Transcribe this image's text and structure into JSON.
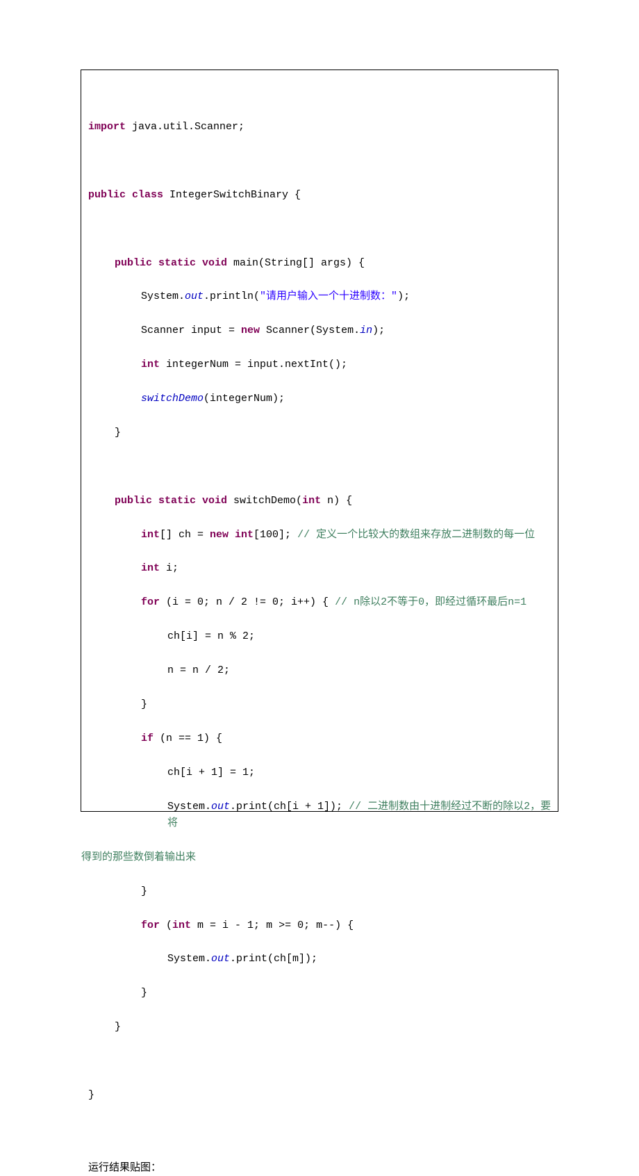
{
  "code": {
    "l1": [
      {
        "t": "import",
        "c": "kw"
      },
      {
        "t": " java.util.Scanner;",
        "c": "txt"
      }
    ],
    "l2": [
      {
        "t": "public class",
        "c": "kw"
      },
      {
        "t": " IntegerSwitchBinary {",
        "c": "txt"
      }
    ],
    "l3": [
      {
        "t": "public static void",
        "c": "kw"
      },
      {
        "t": " main(String[] args) {",
        "c": "txt"
      }
    ],
    "l4": [
      {
        "t": "System.",
        "c": "txt"
      },
      {
        "t": "out",
        "c": "fld"
      },
      {
        "t": ".println(",
        "c": "txt"
      },
      {
        "t": "\"请用户输入一个十进制数：\"",
        "c": "str"
      },
      {
        "t": ");",
        "c": "txt"
      }
    ],
    "l5": [
      {
        "t": "Scanner input = ",
        "c": "txt"
      },
      {
        "t": "new",
        "c": "kw"
      },
      {
        "t": " Scanner(System.",
        "c": "txt"
      },
      {
        "t": "in",
        "c": "fld"
      },
      {
        "t": ");",
        "c": "txt"
      }
    ],
    "l6": [
      {
        "t": "int",
        "c": "kw"
      },
      {
        "t": " integerNum = input.nextInt();",
        "c": "txt"
      }
    ],
    "l7": [
      {
        "t": "switchDemo",
        "c": "fld"
      },
      {
        "t": "(integerNum);",
        "c": "txt"
      }
    ],
    "l8": [
      {
        "t": "}",
        "c": "txt"
      }
    ],
    "l9": [
      {
        "t": "public static void",
        "c": "kw"
      },
      {
        "t": " switchDemo(",
        "c": "txt"
      },
      {
        "t": "int",
        "c": "kw"
      },
      {
        "t": " n) {",
        "c": "txt"
      }
    ],
    "l10": [
      {
        "t": "int",
        "c": "kw"
      },
      {
        "t": "[] ch = ",
        "c": "txt"
      },
      {
        "t": "new int",
        "c": "kw"
      },
      {
        "t": "[100]; ",
        "c": "txt"
      },
      {
        "t": "// 定义一个比较大的数组来存放二进制数的每一位",
        "c": "cmt"
      }
    ],
    "l11": [
      {
        "t": "int",
        "c": "kw"
      },
      {
        "t": " i;",
        "c": "txt"
      }
    ],
    "l12": [
      {
        "t": "for",
        "c": "kw"
      },
      {
        "t": " (i = 0; n / 2 != 0; i++) { ",
        "c": "txt"
      },
      {
        "t": "// n除以2不等于0，即经过循环最后n=1",
        "c": "cmt"
      }
    ],
    "l13": [
      {
        "t": "ch[i] = n % 2;",
        "c": "txt"
      }
    ],
    "l14": [
      {
        "t": "n = n / 2;",
        "c": "txt"
      }
    ],
    "l15": [
      {
        "t": "}",
        "c": "txt"
      }
    ],
    "l16": [
      {
        "t": "if",
        "c": "kw"
      },
      {
        "t": " (n == 1) {",
        "c": "txt"
      }
    ],
    "l17": [
      {
        "t": "ch[i + 1] = 1;",
        "c": "txt"
      }
    ],
    "l18a": [
      {
        "t": "System.",
        "c": "txt"
      },
      {
        "t": "out",
        "c": "fld"
      },
      {
        "t": ".print(ch[i + 1]); ",
        "c": "txt"
      },
      {
        "t": "// 二进制数由十进制经过不断的除以2，要将",
        "c": "cmt"
      }
    ],
    "l18b": [
      {
        "t": "得到的那些数倒着输出来",
        "c": "cmt"
      }
    ],
    "l19": [
      {
        "t": "}",
        "c": "txt"
      }
    ],
    "l20": [
      {
        "t": "for",
        "c": "kw"
      },
      {
        "t": " (",
        "c": "txt"
      },
      {
        "t": "int",
        "c": "kw"
      },
      {
        "t": " m = i - 1; m >= 0; m--) {",
        "c": "txt"
      }
    ],
    "l21": [
      {
        "t": "System.",
        "c": "txt"
      },
      {
        "t": "out",
        "c": "fld"
      },
      {
        "t": ".print(ch[m]);",
        "c": "txt"
      }
    ],
    "l22": [
      {
        "t": "}",
        "c": "txt"
      }
    ],
    "l23": [
      {
        "t": "}",
        "c": "txt"
      }
    ],
    "l24": [
      {
        "t": "}",
        "c": "txt"
      }
    ]
  },
  "result_label": "运行结果贴图："
}
